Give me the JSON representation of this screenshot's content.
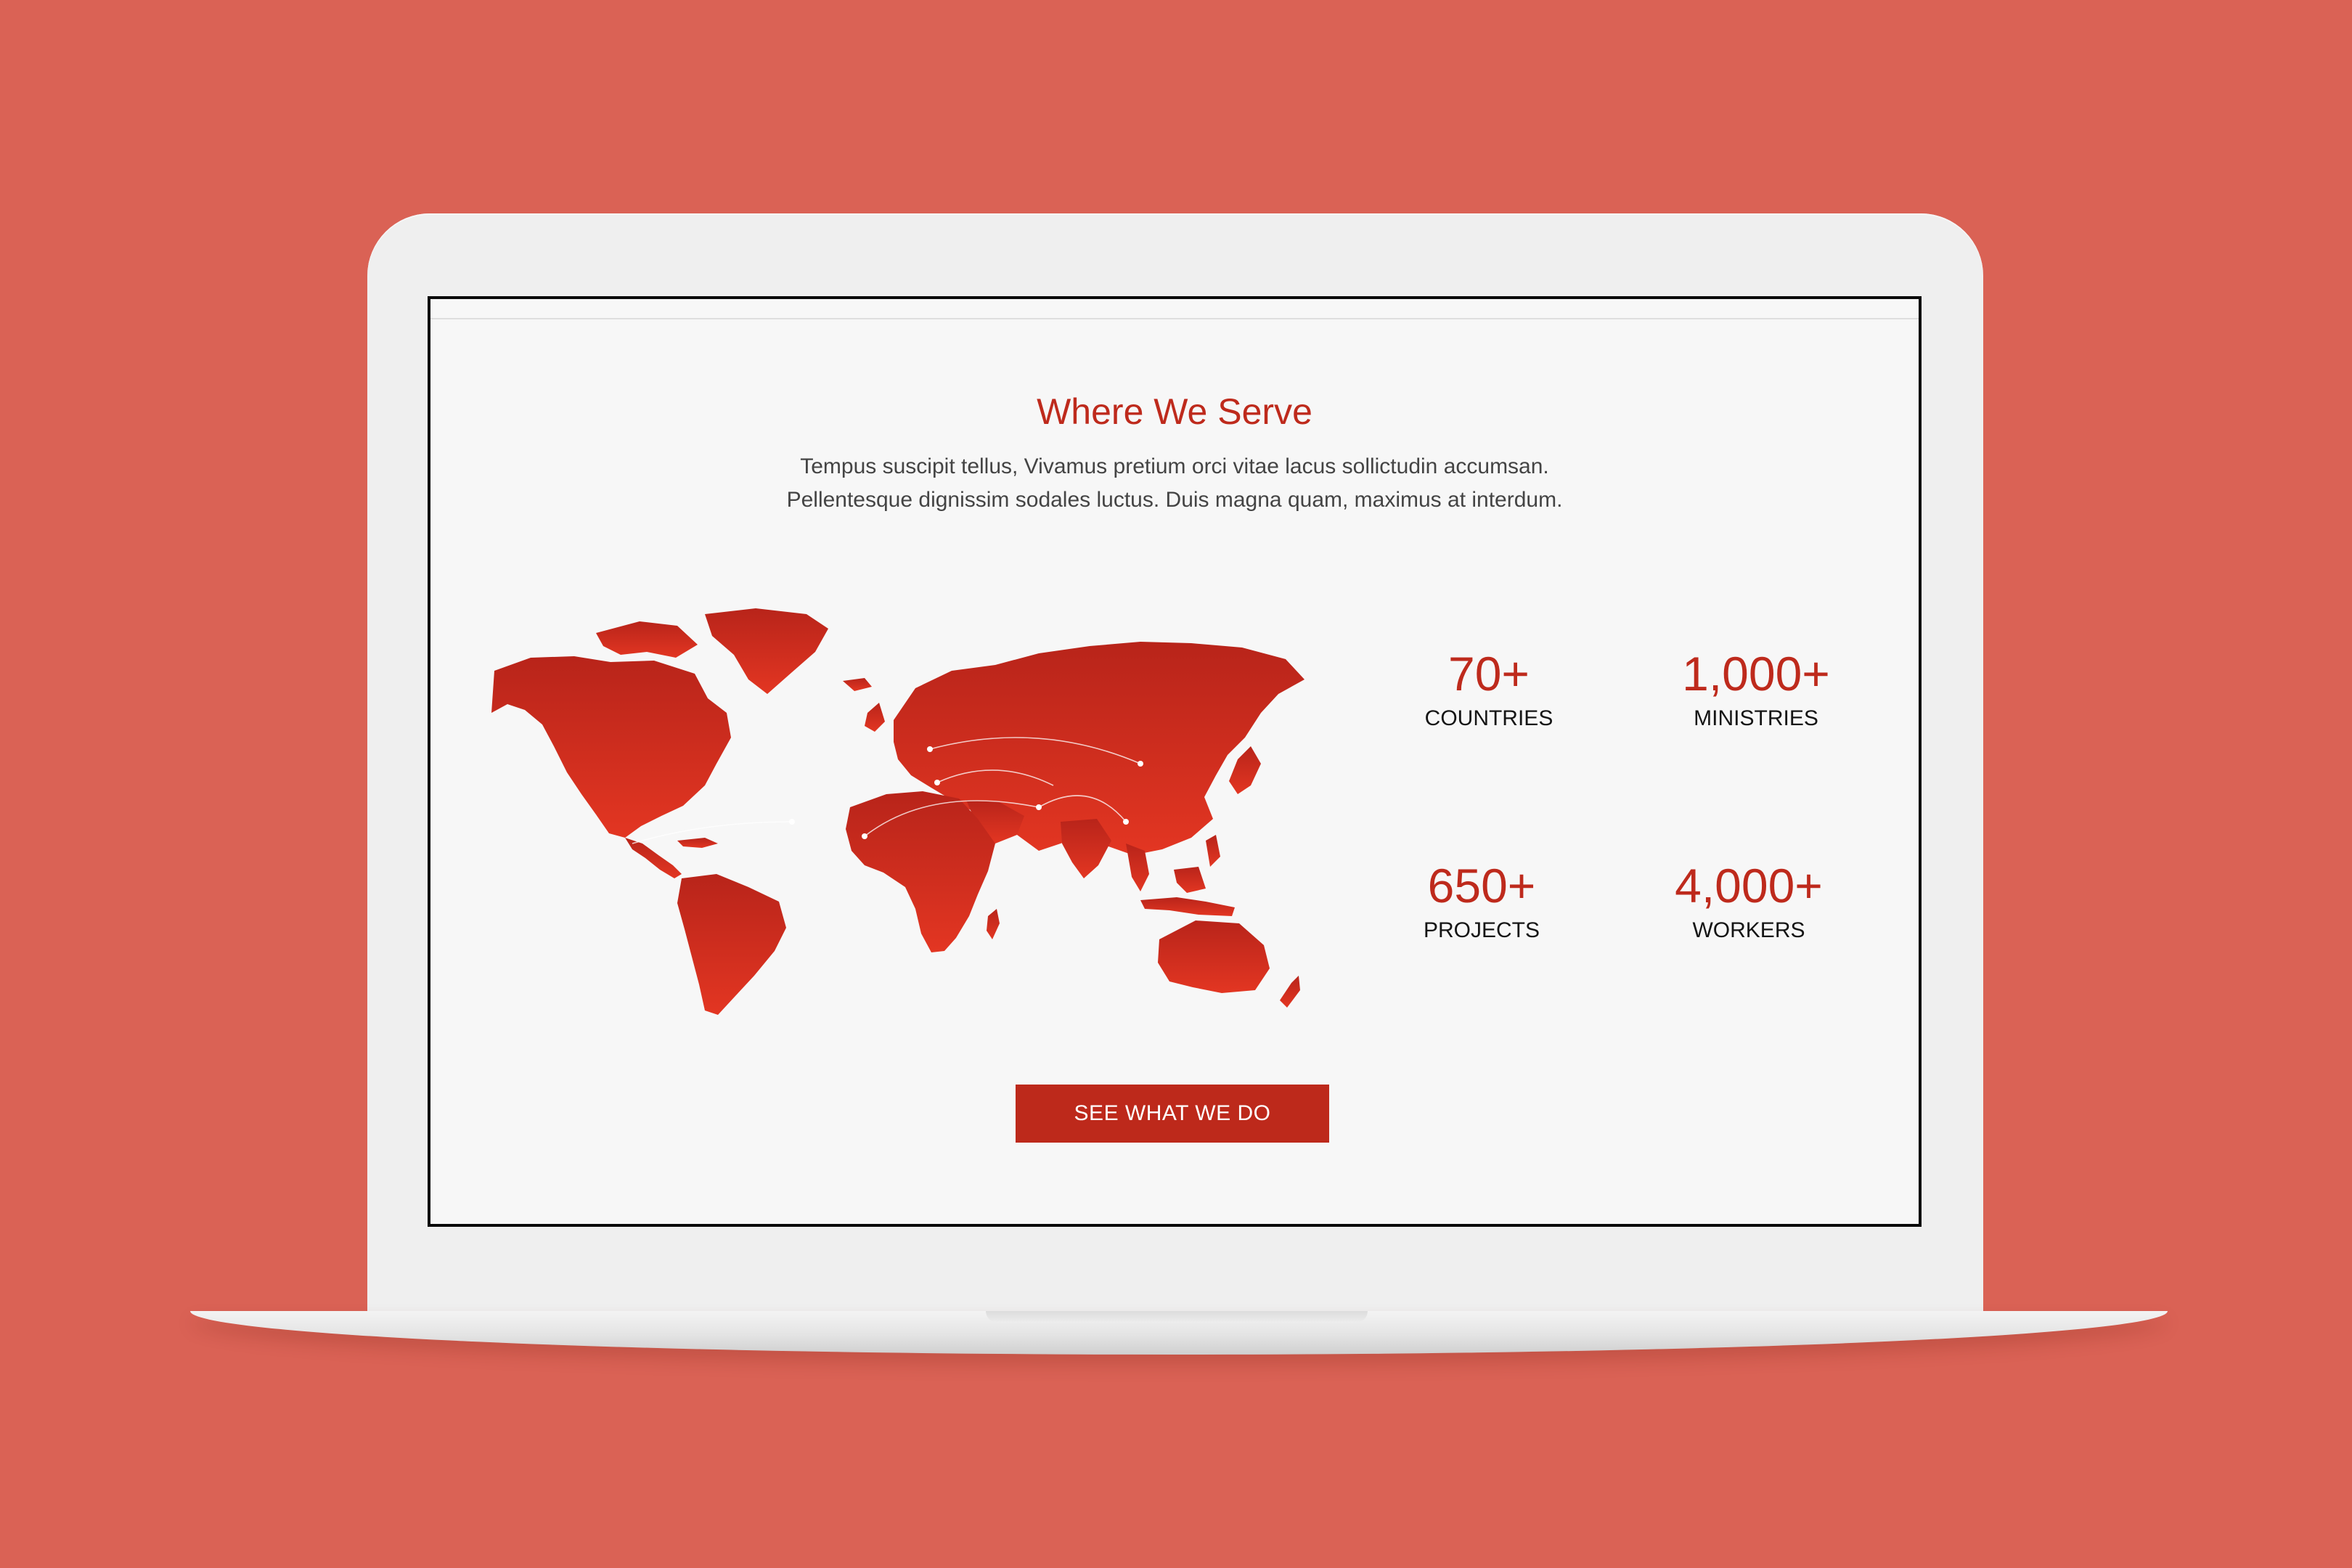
{
  "section": {
    "title": "Where We Serve",
    "description_line1": "Tempus suscipit tellus, Vivamus pretium orci vitae lacus sollictudin accumsan.",
    "description_line2": "Pellentesque dignissim sodales luctus. Duis magna quam, maximus at interdum."
  },
  "stats": [
    {
      "value": "70+",
      "label": "COUNTRIES"
    },
    {
      "value": "1,000+",
      "label": "MINISTRIES"
    },
    {
      "value": "650+",
      "label": "PROJECTS"
    },
    {
      "value": "4,000+",
      "label": "WORKERS"
    }
  ],
  "cta": {
    "label": "SEE WHAT WE DO"
  },
  "map": {
    "icon": "world-map-icon"
  },
  "colors": {
    "background": "#DA6255",
    "accent": "#BE2A1C",
    "map_top": "#B8241A",
    "map_bottom": "#E33622",
    "screen_background": "#F7F7F7",
    "device_frame": "#EFEFEF"
  }
}
